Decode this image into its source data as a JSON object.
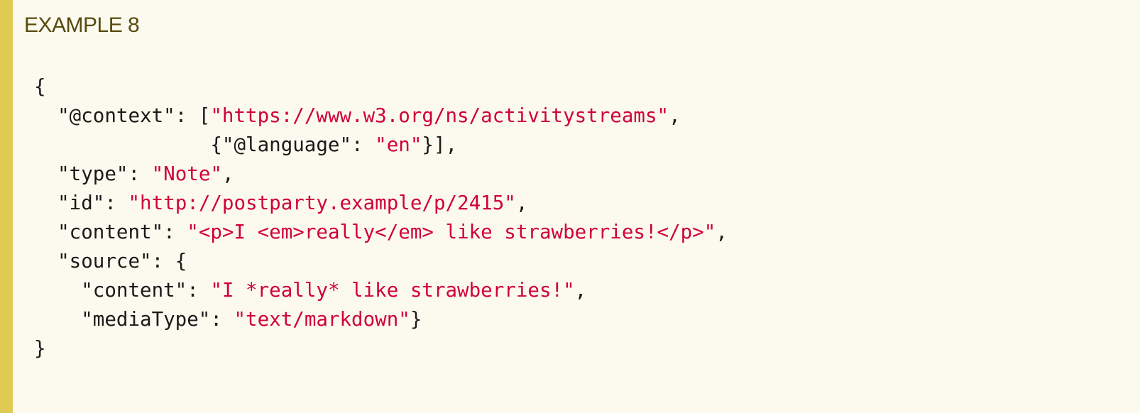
{
  "example": {
    "title": "EXAMPLE 8"
  },
  "code": {
    "lines": [
      [
        {
          "type": "punct",
          "text": "{"
        }
      ],
      [
        {
          "type": "punct",
          "text": "  "
        },
        {
          "type": "key",
          "text": "\"@context\""
        },
        {
          "type": "punct",
          "text": ": ["
        },
        {
          "type": "str",
          "text": "\"https://www.w3.org/ns/activitystreams\""
        },
        {
          "type": "punct",
          "text": ","
        }
      ],
      [
        {
          "type": "punct",
          "text": "               {"
        },
        {
          "type": "key",
          "text": "\"@language\""
        },
        {
          "type": "punct",
          "text": ": "
        },
        {
          "type": "str",
          "text": "\"en\""
        },
        {
          "type": "punct",
          "text": "}],"
        }
      ],
      [
        {
          "type": "punct",
          "text": "  "
        },
        {
          "type": "key",
          "text": "\"type\""
        },
        {
          "type": "punct",
          "text": ": "
        },
        {
          "type": "str",
          "text": "\"Note\""
        },
        {
          "type": "punct",
          "text": ","
        }
      ],
      [
        {
          "type": "punct",
          "text": "  "
        },
        {
          "type": "key",
          "text": "\"id\""
        },
        {
          "type": "punct",
          "text": ": "
        },
        {
          "type": "str",
          "text": "\"http://postparty.example/p/2415\""
        },
        {
          "type": "punct",
          "text": ","
        }
      ],
      [
        {
          "type": "punct",
          "text": "  "
        },
        {
          "type": "key",
          "text": "\"content\""
        },
        {
          "type": "punct",
          "text": ": "
        },
        {
          "type": "str",
          "text": "\"<p>I <em>really</em> like strawberries!</p>\""
        },
        {
          "type": "punct",
          "text": ","
        }
      ],
      [
        {
          "type": "punct",
          "text": "  "
        },
        {
          "type": "key",
          "text": "\"source\""
        },
        {
          "type": "punct",
          "text": ": {"
        }
      ],
      [
        {
          "type": "punct",
          "text": "    "
        },
        {
          "type": "key",
          "text": "\"content\""
        },
        {
          "type": "punct",
          "text": ": "
        },
        {
          "type": "str",
          "text": "\"I *really* like strawberries!\""
        },
        {
          "type": "punct",
          "text": ","
        }
      ],
      [
        {
          "type": "punct",
          "text": "    "
        },
        {
          "type": "key",
          "text": "\"mediaType\""
        },
        {
          "type": "punct",
          "text": ": "
        },
        {
          "type": "str",
          "text": "\"text/markdown\""
        },
        {
          "type": "punct",
          "text": "}"
        }
      ],
      [
        {
          "type": "punct",
          "text": "}"
        }
      ]
    ]
  },
  "colors": {
    "background": "#fcfaee",
    "accent_border": "#e0cb52",
    "title": "#574b0f",
    "string": "#d0003a",
    "text": "#1a1a1a"
  }
}
